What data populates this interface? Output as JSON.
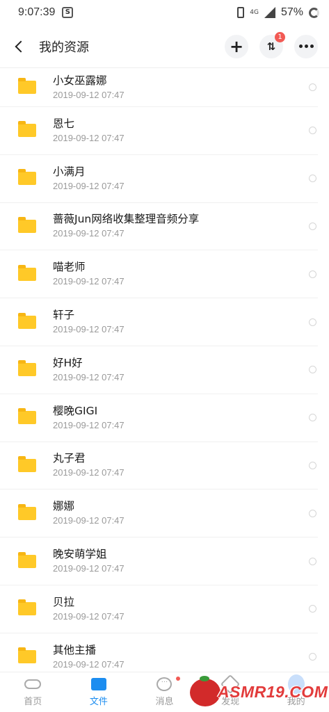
{
  "status_bar": {
    "time": "9:07:39",
    "app_icon": "S",
    "network": "4G",
    "battery_percent": "57%"
  },
  "header": {
    "title": "我的资源",
    "transfer_badge": "1"
  },
  "folders": [
    {
      "name": "小女巫露娜",
      "date": "2019-09-12 07:47"
    },
    {
      "name": "恩七",
      "date": "2019-09-12 07:47"
    },
    {
      "name": "小满月",
      "date": "2019-09-12 07:47"
    },
    {
      "name": "蔷薇Jun网络收集整理音频分享",
      "date": "2019-09-12 07:47"
    },
    {
      "name": "喵老师",
      "date": "2019-09-12 07:47"
    },
    {
      "name": "轩子",
      "date": "2019-09-12 07:47"
    },
    {
      "name": "好H好",
      "date": "2019-09-12 07:47"
    },
    {
      "name": "樱晚GIGI",
      "date": "2019-09-12 07:47"
    },
    {
      "name": "丸子君",
      "date": "2019-09-12 07:47"
    },
    {
      "name": "娜娜",
      "date": "2019-09-12 07:47"
    },
    {
      "name": "晚安萌学姐",
      "date": "2019-09-12 07:47"
    },
    {
      "name": "贝拉",
      "date": "2019-09-12 07:47"
    },
    {
      "name": "其他主播",
      "date": "2019-09-12 07:47"
    }
  ],
  "bottom_nav": {
    "home": "首页",
    "files": "文件",
    "messages": "消息",
    "discover": "发现",
    "me": "我的"
  },
  "watermark": {
    "text": "ASMR19.COM"
  },
  "colors": {
    "accent": "#1c8df0",
    "folder": "#ffc928",
    "badge": "#f25a54"
  }
}
